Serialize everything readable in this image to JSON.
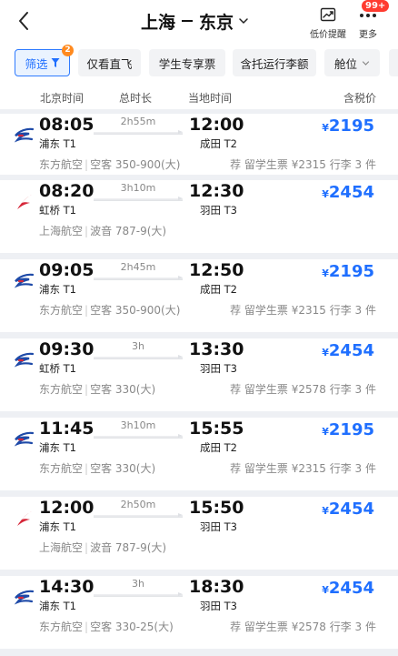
{
  "header": {
    "origin": "上海",
    "destination": "东京",
    "price_alert_label": "低价提醒",
    "more_label": "更多",
    "more_badge": "99+"
  },
  "filters": {
    "filter_label": "筛选",
    "filter_count": "2",
    "chips": [
      "仅看直飞",
      "学生专享票",
      "含托运行李额",
      "舱位"
    ]
  },
  "columns": {
    "beijing_time": "北京时间",
    "total_duration": "总时长",
    "local_time": "当地时间",
    "tax_included_price": "含税价"
  },
  "airline_colors": {
    "china-eastern": "#1e4aa8",
    "shanghai-airlines": "#d6283a"
  },
  "flights": [
    {
      "dep_time": "08:05",
      "dep_airport": "浦东 T1",
      "duration": "2h55m",
      "arr_time": "12:00",
      "arr_airport": "成田 T2",
      "currency": "¥",
      "price": "2195",
      "airline": "东方航空",
      "aircraft": "空客 350-900(大)",
      "extra": "荐 留学生票 ¥2315 行李 3 件",
      "logo": "china-eastern"
    },
    {
      "dep_time": "08:20",
      "dep_airport": "虹桥 T1",
      "duration": "3h10m",
      "arr_time": "12:30",
      "arr_airport": "羽田 T3",
      "currency": "¥",
      "price": "2454",
      "airline": "上海航空",
      "aircraft": "波音 787-9(大)",
      "extra": "",
      "logo": "shanghai-airlines"
    },
    {
      "dep_time": "09:05",
      "dep_airport": "浦东 T1",
      "duration": "2h45m",
      "arr_time": "12:50",
      "arr_airport": "成田 T2",
      "currency": "¥",
      "price": "2195",
      "airline": "东方航空",
      "aircraft": "空客 350-900(大)",
      "extra": "荐 留学生票 ¥2315 行李 3 件",
      "logo": "china-eastern"
    },
    {
      "dep_time": "09:30",
      "dep_airport": "虹桥 T1",
      "duration": "3h",
      "arr_time": "13:30",
      "arr_airport": "羽田 T3",
      "currency": "¥",
      "price": "2454",
      "airline": "东方航空",
      "aircraft": "空客 330(大)",
      "extra": "荐 留学生票 ¥2578 行李 3 件",
      "logo": "china-eastern"
    },
    {
      "dep_time": "11:45",
      "dep_airport": "浦东 T1",
      "duration": "3h10m",
      "arr_time": "15:55",
      "arr_airport": "成田 T2",
      "currency": "¥",
      "price": "2195",
      "airline": "东方航空",
      "aircraft": "空客 330(大)",
      "extra": "荐 留学生票 ¥2315 行李 3 件",
      "logo": "china-eastern"
    },
    {
      "dep_time": "12:00",
      "dep_airport": "浦东 T1",
      "duration": "2h50m",
      "arr_time": "15:50",
      "arr_airport": "羽田 T3",
      "currency": "¥",
      "price": "2454",
      "airline": "上海航空",
      "aircraft": "波音 787-9(大)",
      "extra": "",
      "logo": "shanghai-airlines"
    },
    {
      "dep_time": "14:30",
      "dep_airport": "浦东 T1",
      "duration": "3h",
      "arr_time": "18:30",
      "arr_airport": "羽田 T3",
      "currency": "¥",
      "price": "2454",
      "airline": "东方航空",
      "aircraft": "空客 330-25(大)",
      "extra": "荐 留学生票 ¥2578 行李 3 件",
      "logo": "china-eastern"
    }
  ]
}
